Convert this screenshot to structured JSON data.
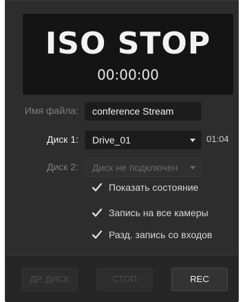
{
  "display": {
    "status": "ISO STOP",
    "timecode": "00:00:00"
  },
  "form": {
    "filename_label": "Имя файла:",
    "filename_value": "conference Stream",
    "disk1_label": "Диск 1:",
    "disk1_value": "Drive_01",
    "disk1_duration": "01:04",
    "disk2_label": "Диск 2:",
    "disk2_value": "Диск не подключен"
  },
  "options": [
    {
      "label": "Показать состояние",
      "checked": true
    },
    {
      "label": "Запись на все камеры",
      "checked": true
    },
    {
      "label": "Разд. запись со входов",
      "checked": true
    }
  ],
  "buttons": {
    "other_disk": "ДР. ДИСК",
    "stop": "СТОП",
    "rec": "REC"
  }
}
